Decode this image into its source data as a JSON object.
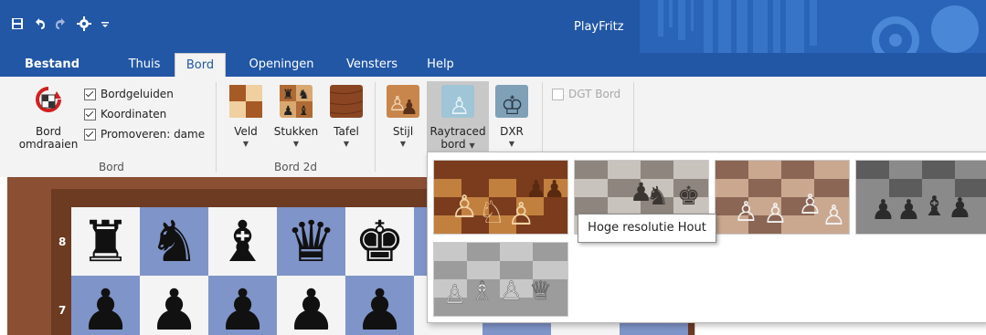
{
  "app": {
    "title": "PlayFritz"
  },
  "quick_access": [
    {
      "icon": "save-icon"
    },
    {
      "icon": "undo-icon"
    },
    {
      "icon": "redo-icon"
    },
    {
      "icon": "engine-icon"
    },
    {
      "icon": "qat-menu-icon"
    }
  ],
  "tabs": [
    {
      "label": "Bestand"
    },
    {
      "label": "Thuis"
    },
    {
      "label": "Bord"
    },
    {
      "label": "Openingen"
    },
    {
      "label": "Vensters"
    },
    {
      "label": "Help"
    }
  ],
  "active_tab": "Bord",
  "ribbon": {
    "bord_group": {
      "label": "Bord",
      "flip_button": {
        "line1": "Bord",
        "line2": "omdraaien"
      },
      "checkboxes": [
        {
          "label": "Bordgeluiden",
          "checked": true
        },
        {
          "label": "Koordinaten",
          "checked": true
        },
        {
          "label": "Promoveren: dame",
          "checked": true
        }
      ]
    },
    "bord2d_group": {
      "label": "Bord 2d",
      "buttons": [
        {
          "label": "Veld"
        },
        {
          "label": "Stukken"
        },
        {
          "label": "Tafel"
        }
      ]
    },
    "bord3d_group": {
      "buttons": [
        {
          "label": "Stijl"
        },
        {
          "line1": "Raytraced",
          "line2": "bord"
        },
        {
          "label": "DXR"
        }
      ]
    },
    "dgt": {
      "label": "DGT Bord",
      "checked": false,
      "enabled": false
    }
  },
  "board": {
    "ranks": [
      "8",
      "7"
    ],
    "rank8": [
      "♜",
      "♞",
      "♝",
      "♛",
      "♚"
    ],
    "rank7": [
      "♟",
      "♟",
      "♟",
      "♟",
      "♟"
    ]
  },
  "popup": {
    "tooltip": "Hoge resolutie Hout",
    "thumbnails": [
      {
        "icon": "wood-board-thumbnail"
      },
      {
        "icon": "high-res-wood-thumbnail"
      },
      {
        "icon": "marble-board-thumbnail"
      },
      {
        "icon": "dark-metal-thumbnail"
      },
      {
        "icon": "glass-board-thumbnail"
      }
    ]
  },
  "colors": {
    "title_bar": "#2257a6",
    "ribbon_bg": "#f3f3f3",
    "board_dark": "#7f94c8",
    "board_light": "#f4f4f4",
    "board_frame": "#8b4f33"
  }
}
